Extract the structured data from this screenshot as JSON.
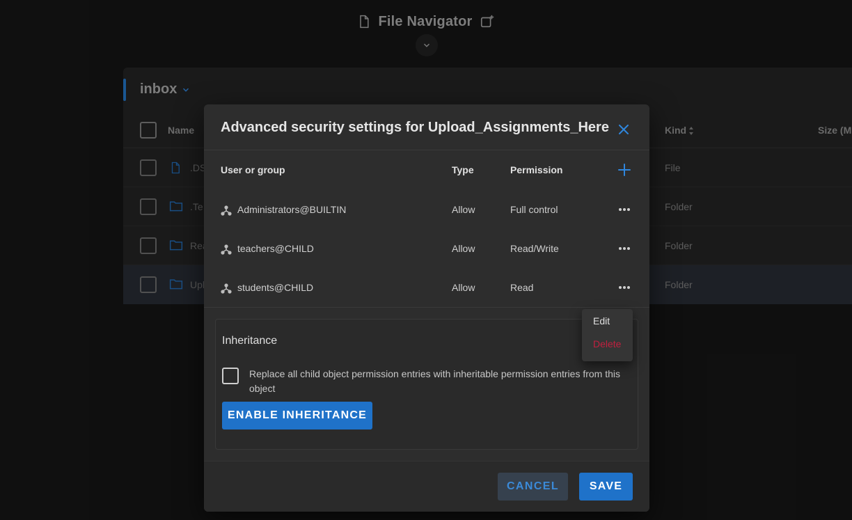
{
  "app": {
    "title": "File Navigator"
  },
  "panel": {
    "folder_title": "inbox",
    "columns": {
      "name": "Name",
      "kind": "Kind",
      "size": "Size (M"
    },
    "rows": [
      {
        "name": ".DS",
        "kind": "File",
        "icon": "file-icon"
      },
      {
        "name": ".Te",
        "kind": "Folder",
        "icon": "folder-icon"
      },
      {
        "name": "Rea",
        "kind": "Folder",
        "icon": "folder-icon"
      },
      {
        "name": "Upl",
        "kind": "Folder",
        "icon": "folder-icon"
      }
    ]
  },
  "dialog": {
    "title": "Advanced security settings for Upload_Assignments_Here",
    "columns": {
      "user": "User or group",
      "type": "Type",
      "permission": "Permission"
    },
    "entries": [
      {
        "user": "Administrators@BUILTIN",
        "type": "Allow",
        "permission": "Full control"
      },
      {
        "user": "teachers@CHILD",
        "type": "Allow",
        "permission": "Read/Write"
      },
      {
        "user": "students@CHILD",
        "type": "Allow",
        "permission": "Read"
      }
    ],
    "inheritance": {
      "title": "Inheritance",
      "replace_label": "Replace all child object permission entries with inheritable permission entries from this object",
      "enable_label": "ENABLE INHERITANCE"
    },
    "footer": {
      "cancel_label": "CANCEL",
      "save_label": "SAVE"
    }
  },
  "context_menu": {
    "edit_label": "Edit",
    "delete_label": "Delete"
  },
  "colors": {
    "accent": "#1f72c9",
    "danger": "#c0203f",
    "dialog_bg": "#2d2d2d",
    "page_bg": "#121212"
  }
}
